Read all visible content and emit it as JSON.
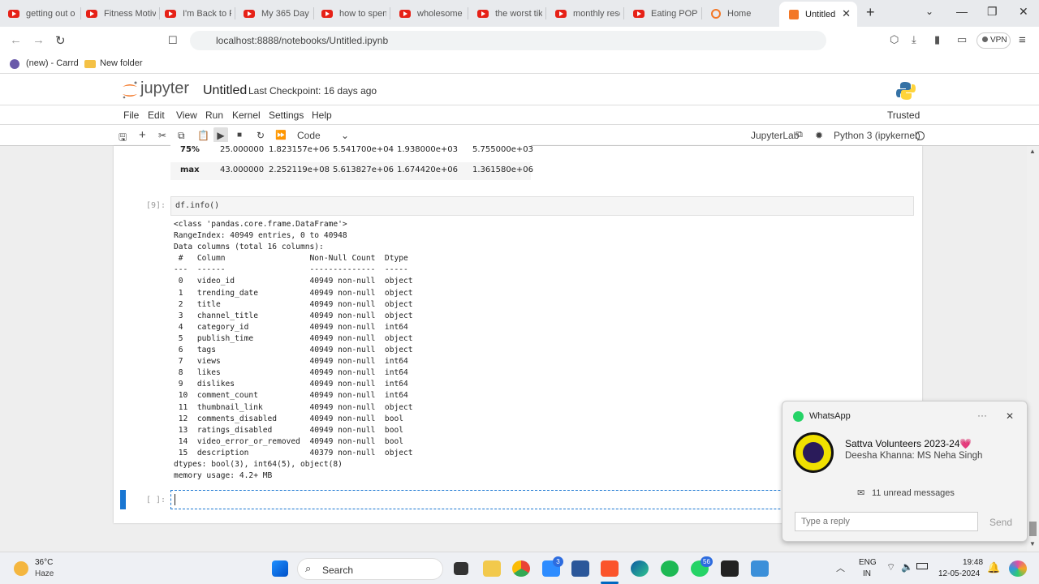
{
  "browser": {
    "tabs": [
      "getting out o",
      "Fitness Motiv",
      "I'm Back to P",
      "My 365 Day",
      "how to spen",
      "wholesome c",
      "the worst tik",
      "monthly rese",
      "Eating POPUl",
      "Home"
    ],
    "active_tab": "Untitled",
    "url": "localhost:8888/notebooks/Untitled.ipynb",
    "bookmarks": [
      "(new) - Carrd",
      "New folder"
    ],
    "vpn": "VPN"
  },
  "jupyter": {
    "logo": "jupyter",
    "title": "Untitled",
    "checkpoint": "Last Checkpoint: 16 days ago",
    "trusted": "Trusted",
    "menu": [
      "File",
      "Edit",
      "View",
      "Run",
      "Kernel",
      "Settings",
      "Help"
    ],
    "cell_type": "Code",
    "jupyterlab": "JupyterLab",
    "kernel": "Python 3 (ipykernel)"
  },
  "describe": {
    "rows": [
      {
        "label": "75%",
        "vals": [
          "25.000000",
          "1.823157e+06",
          "5.541700e+04",
          "1.938000e+03",
          "5.755000e+03"
        ]
      },
      {
        "label": "max",
        "vals": [
          "43.000000",
          "2.252119e+08",
          "5.613827e+06",
          "1.674420e+06",
          "1.361580e+06"
        ]
      }
    ]
  },
  "cell9": {
    "prompt": "[9]:",
    "code": "df.info()",
    "output": "<class 'pandas.core.frame.DataFrame'>\nRangeIndex: 40949 entries, 0 to 40948\nData columns (total 16 columns):\n #   Column                  Non-Null Count  Dtype \n---  ------                  --------------  ----- \n 0   video_id                40949 non-null  object\n 1   trending_date           40949 non-null  object\n 2   title                   40949 non-null  object\n 3   channel_title           40949 non-null  object\n 4   category_id             40949 non-null  int64 \n 5   publish_time            40949 non-null  object\n 6   tags                    40949 non-null  object\n 7   views                   40949 non-null  int64 \n 8   likes                   40949 non-null  int64 \n 9   dislikes                40949 non-null  int64 \n 10  comment_count           40949 non-null  int64 \n 11  thumbnail_link          40949 non-null  object\n 12  comments_disabled       40949 non-null  bool  \n 13  ratings_disabled        40949 non-null  bool  \n 14  video_error_or_removed  40949 non-null  bool  \n 15  description             40379 non-null  object\ndtypes: bool(3), int64(5), object(8)\nmemory usage: 4.2+ MB"
  },
  "empty_prompt": "[ ]:",
  "whatsapp": {
    "app": "WhatsApp",
    "group": "Sattva Volunteers 2023-24💗",
    "message": "Deesha Khanna: MS Neha Singh",
    "unread": "11 unread messages",
    "reply_placeholder": "Type a reply",
    "send": "Send"
  },
  "taskbar": {
    "temp": "36°C",
    "weather": "Haze",
    "search": "Search",
    "lang1": "ENG",
    "lang2": "IN",
    "time": "19:48",
    "date": "12-05-2024",
    "badge_teams": "3",
    "badge_whatsapp": "56"
  }
}
